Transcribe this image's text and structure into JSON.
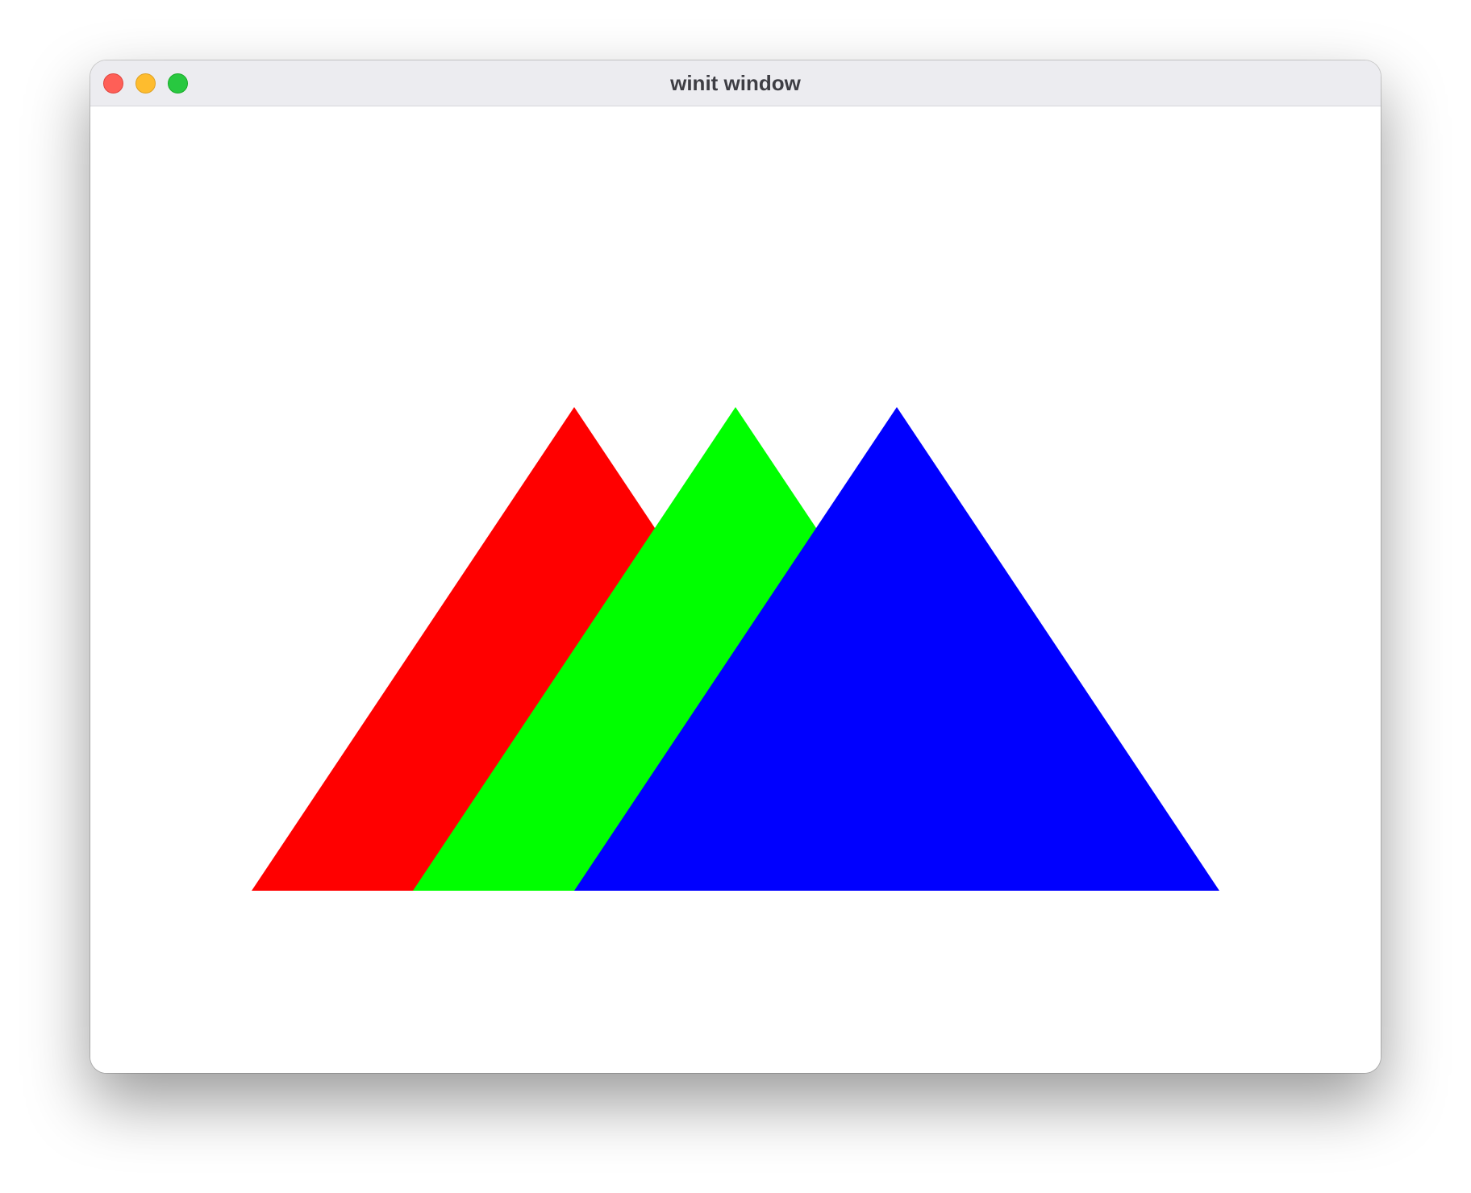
{
  "window": {
    "title": "winit window"
  },
  "title_bar_buttons": [
    {
      "name": "close",
      "color": "#fe5f57"
    },
    {
      "name": "minimize",
      "color": "#febc2e"
    },
    {
      "name": "zoom",
      "color": "#28c840"
    }
  ],
  "canvas": {
    "background": "#ffffff",
    "shapes": [
      {
        "name": "red-triangle",
        "color": "#ff0000"
      },
      {
        "name": "green-triangle",
        "color": "#00ff00"
      },
      {
        "name": "blue-triangle",
        "color": "#0000ff"
      }
    ]
  }
}
